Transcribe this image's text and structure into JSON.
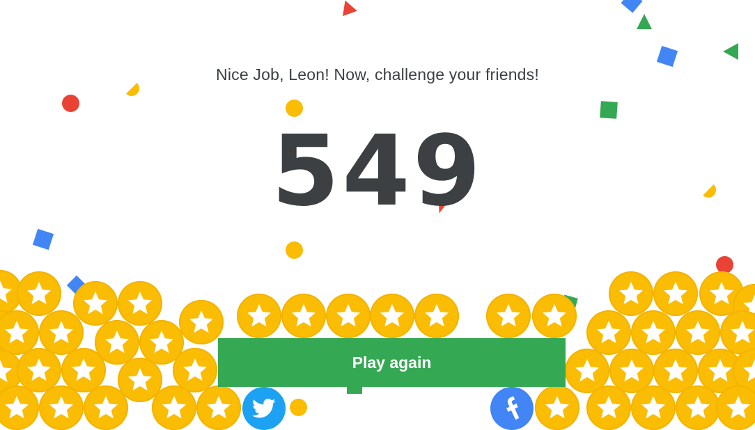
{
  "game": {
    "message": "Nice Job, Leon! Now, challenge your friends!",
    "score": "549",
    "play_again_label": "Play again"
  },
  "share": {
    "twitter_icon": "twitter-bird-icon",
    "facebook_icon": "facebook-f-icon"
  },
  "colors": {
    "coin": "#fbbc04",
    "play_button": "#34a853",
    "twitter": "#1da1f2",
    "facebook": "#4285f4",
    "text": "#3c4043",
    "confetti": [
      "#ea4335",
      "#4285f4",
      "#34a853",
      "#fbbc04"
    ]
  },
  "icons": {
    "coin": "star-coin-icon"
  }
}
